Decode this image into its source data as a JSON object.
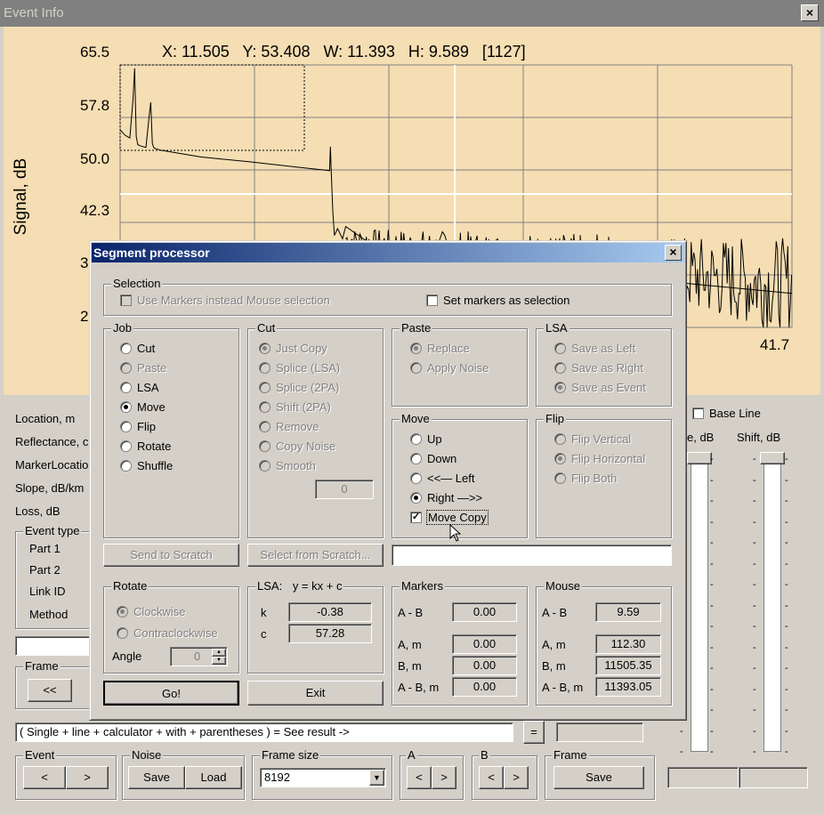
{
  "window": {
    "title": "Event Info",
    "close": "×"
  },
  "chart": {
    "y_ticks": [
      "65.5",
      "57.8",
      "50.0",
      "42.3",
      "3",
      "2"
    ],
    "x_end_label": "41.7",
    "ylabel": "Signal, dB",
    "readout": "X: 11.505   Y: 53.408   W: 11.393   H: 9.589   [1127]"
  },
  "chart_data": {
    "type": "line",
    "ylabel": "Signal, dB",
    "ylim": [
      27.0,
      65.5
    ],
    "x": [
      0.0,
      0.3,
      0.6,
      0.8,
      0.9,
      1.0,
      1.1,
      1.3,
      1.6,
      1.8,
      1.9,
      2.0,
      2.1,
      2.5,
      5.0,
      8.0,
      11.0,
      13.0,
      13.05,
      13.1,
      13.2,
      13.3,
      13.5,
      13.8,
      14.0,
      16.0,
      20.0,
      25.0,
      30.0,
      35.0,
      41.7
    ],
    "y": [
      56.0,
      55.2,
      54.8,
      60.5,
      65.0,
      55.0,
      53.8,
      53.6,
      53.4,
      58.0,
      60.0,
      54.0,
      53.3,
      53.0,
      52.0,
      51.3,
      50.5,
      50.0,
      53.5,
      50.0,
      44.0,
      40.5,
      41.5,
      40.0,
      41.8,
      38.5,
      37.0,
      36.0,
      34.5,
      33.5,
      32.0
    ]
  },
  "left_panel": {
    "labels": [
      "Location, m",
      "Reflectance, c",
      "MarkerLocatio",
      "Slope, dB/km",
      "Loss, dB"
    ],
    "event_type_label": "Event type",
    "event_type_items": [
      "Part 1",
      "Part 2",
      "Link ID",
      "Method"
    ],
    "frame_label": "Frame",
    "frame_prev": "<<"
  },
  "right_panel": {
    "base_line": "Base Line",
    "col1_label": "e, dB",
    "col2_label": "Shift, dB"
  },
  "bottom": {
    "calc_value": "( Single + line + calculator + with + parentheses ) = See result ->",
    "equals": "=",
    "event_label": "Event",
    "noise_label": "Noise",
    "save": "Save",
    "load": "Load",
    "frame_size_label": "Frame size",
    "frame_size_value": "8192",
    "a_label": "A",
    "b_label": "B",
    "frame_label": "Frame",
    "frame_save": "Save",
    "prev": "<",
    "next": ">"
  },
  "dialog": {
    "title": "Segment processor",
    "close": "×",
    "selection": {
      "label": "Selection",
      "use_markers": "Use Markers instead Mouse selection",
      "set_markers": "Set markers as selection"
    },
    "job": {
      "label": "Job",
      "items": [
        "Cut",
        "Paste",
        "LSA",
        "Move",
        "Flip",
        "Rotate",
        "Shuffle"
      ]
    },
    "cut": {
      "label": "Cut",
      "items": [
        "Just Copy",
        "Splice (LSA)",
        "Splice (2PA)",
        "Shift (2PA)",
        "Remove",
        "Copy Noise",
        "Smooth"
      ],
      "smooth_value": "0"
    },
    "paste": {
      "label": "Paste",
      "items": [
        "Replace",
        "Apply Noise"
      ]
    },
    "lsa": {
      "label": "LSA",
      "items": [
        "Save as Left",
        "Save as Right",
        "Save as Event"
      ]
    },
    "move": {
      "label": "Move",
      "items": [
        "Up",
        "Down",
        "<<— Left",
        "Right —>>"
      ],
      "move_copy": "Move Copy"
    },
    "flip": {
      "label": "Flip",
      "items": [
        "Flip Vertical",
        "Flip Horizontal",
        "Flip Both"
      ]
    },
    "send_scratch": "Send to Scratch",
    "select_scratch": "Select from Scratch...",
    "rotate": {
      "label": "Rotate",
      "clockwise": "Clockwise",
      "counter": "Contraclockwise",
      "angle_label": "Angle",
      "angle_value": "0"
    },
    "lsa_eq": {
      "label": "LSA:",
      "formula": "y = kx + c",
      "k_label": "k",
      "k_value": "-0.38",
      "c_label": "c",
      "c_value": "57.28"
    },
    "markers": {
      "label": "Markers",
      "ab_label": "A - B",
      "ab_value": "0.00",
      "a_label": "A, m",
      "a_value": "0.00",
      "b_label": "B, m",
      "b_value": "0.00",
      "abm_label": "A - B, m",
      "abm_value": "0.00"
    },
    "mouse": {
      "label": "Mouse",
      "ab_label": "A - B",
      "ab_value": "9.59",
      "a_label": "A, m",
      "a_value": "112.30",
      "b_label": "B, m",
      "b_value": "11505.35",
      "abm_label": "A - B, m",
      "abm_value": "11393.05"
    },
    "go": "Go!",
    "exit": "Exit"
  }
}
